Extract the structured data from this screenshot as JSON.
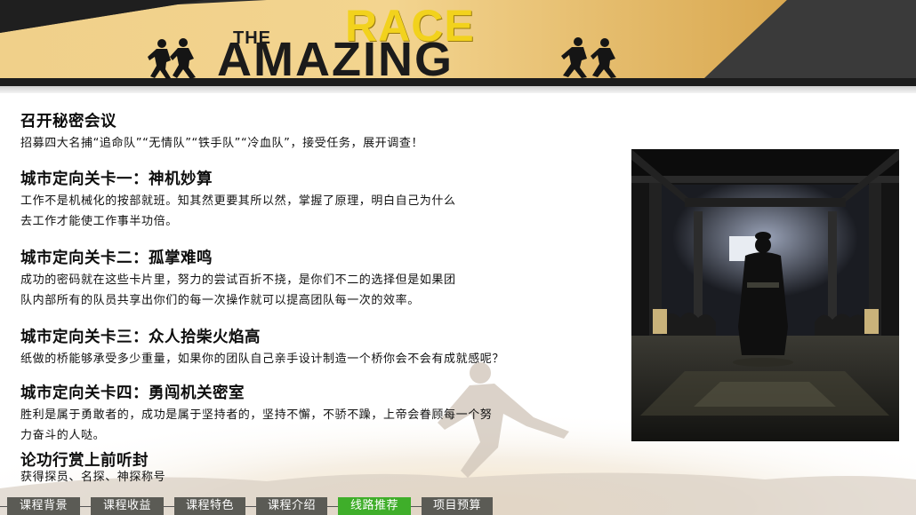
{
  "banner": {
    "logo_the": "THE",
    "logo_race": "RACE",
    "logo_amazing": "AMAZING"
  },
  "sections": [
    {
      "title": "召开秘密会议",
      "body": [
        "招募四大名捕“追命队”“无情队”“铁手队”“冷血队”，接受任务，展开调查！"
      ]
    },
    {
      "title": "城市定向关卡一：神机妙算",
      "body": [
        "工作不是机械化的按部就班。知其然更要其所以然，掌握了原理，明白自己为什么",
        "去工作才能使工作事半功倍。"
      ]
    },
    {
      "title": "城市定向关卡二：孤掌难鸣",
      "body": [
        "成功的密码就在这些卡片里，努力的尝试百折不挠，是你们不二的选择但是如果团",
        "队内部所有的队员共享出你们的每一次操作就可以提高团队每一次的效率。"
      ]
    },
    {
      "title": "城市定向关卡三：众人拾柴火焰高",
      "body": [
        "纸做的桥能够承受多少重量，如果你的团队自己亲手设计制造一个桥你会不会有成就感呢？"
      ]
    },
    {
      "title": "城市定向关卡四：勇闯机关密室",
      "body": [
        "胜利是属于勇敢者的，成功是属于坚持者的，坚持不懈，不骄不躁，上帝会眷顾每一个努",
        "力奋斗的人哒。"
      ]
    },
    {
      "title": "论功行赏上前听封",
      "body": [
        "获得探员、名探、神探称号"
      ]
    }
  ],
  "tabs": [
    {
      "label": "课程背景",
      "active": false
    },
    {
      "label": "课程收益",
      "active": false
    },
    {
      "label": "课程特色",
      "active": false
    },
    {
      "label": "课程介绍",
      "active": false
    },
    {
      "label": "线路推荐",
      "active": true
    },
    {
      "label": "项目预算",
      "active": false
    }
  ],
  "colors": {
    "tab_default": "#5b5b55",
    "tab_active": "#3fae2a",
    "logo_yellow": "#f2d21d",
    "banner_tan": "#e8c274"
  }
}
